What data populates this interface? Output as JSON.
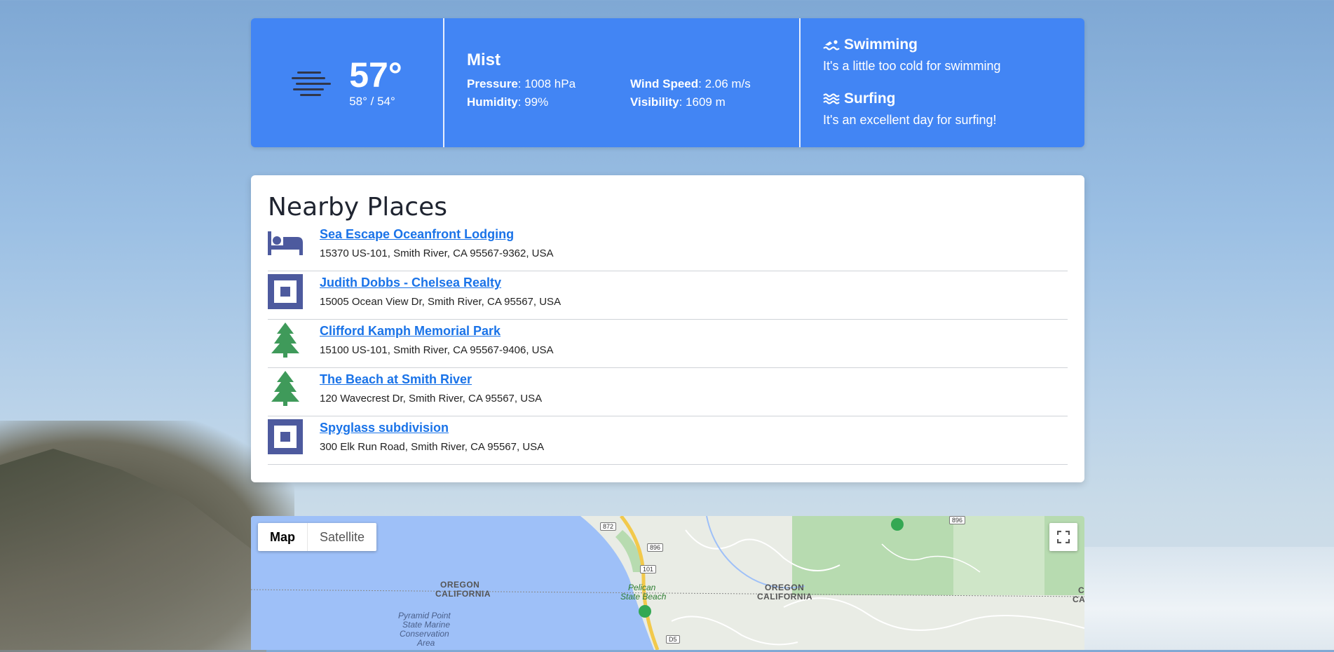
{
  "weather": {
    "temperature": "57°",
    "temp_range": "58° / 54°",
    "condition": "Mist",
    "icon": "mist-icon",
    "details": [
      {
        "label": "Pressure",
        "value": ": 1008 hPa"
      },
      {
        "label": "Wind Speed",
        "value": ": 2.06 m/s"
      },
      {
        "label": "Humidity",
        "value": ": 99%"
      },
      {
        "label": "Visibility",
        "value": ": 1609 m"
      }
    ],
    "activities": [
      {
        "title": "Swimming",
        "icon": "swimmer-icon",
        "text": "It's a little too cold for swimming"
      },
      {
        "title": "Surfing",
        "icon": "water-waves-icon",
        "text": "It's an excellent day for surfing!"
      }
    ]
  },
  "nearby": {
    "title": "Nearby Places",
    "places": [
      {
        "name": "Sea Escape Oceanfront Lodging",
        "address": "15370 US-101, Smith River, CA 95567-9362, USA",
        "icon": "bed-icon"
      },
      {
        "name": "Judith Dobbs - Chelsea Realty",
        "address": "15005 Ocean View Dr, Smith River, CA 95567, USA",
        "icon": "square-icon"
      },
      {
        "name": "Clifford Kamph Memorial Park",
        "address": "15100 US-101, Smith River, CA 95567-9406, USA",
        "icon": "tree-icon"
      },
      {
        "name": "The Beach at Smith River",
        "address": "120 Wavecrest Dr, Smith River, CA 95567, USA",
        "icon": "tree-icon"
      },
      {
        "name": "Spyglass subdivision",
        "address": "300 Elk Run Road, Smith River, CA 95567, USA",
        "icon": "square-icon"
      }
    ]
  },
  "map": {
    "type_map": "Map",
    "type_satellite": "Satellite",
    "labels": {
      "oregon_left": "OREGON",
      "california_left": "CALIFORNIA",
      "pelican": "Pelican",
      "state_beach": "State Beach",
      "oregon_right": "OREGON",
      "california_right": "CALIFORNIA",
      "pyramid": "Pyramid Point",
      "state_marine": "State Marine",
      "conservation": "Conservation",
      "area": "Area",
      "edge_c": "C",
      "edge_ca": "CA"
    },
    "shields": [
      "872",
      "896",
      "101",
      "896",
      "D5"
    ],
    "colors": {
      "water": "#9ec0f8",
      "land": "#e9ece5",
      "park": "#a8d5a0"
    }
  }
}
